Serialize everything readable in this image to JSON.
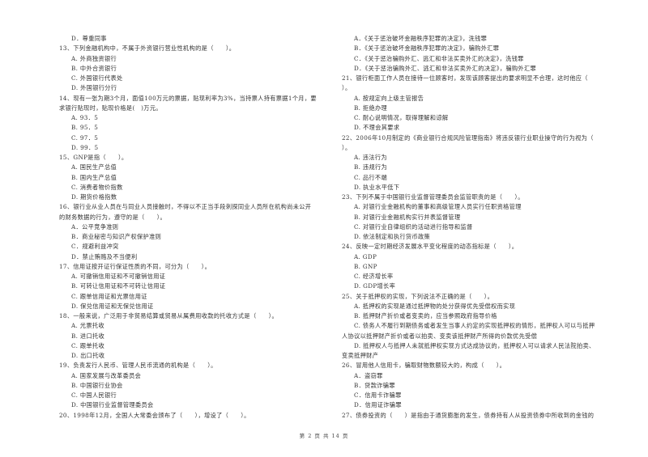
{
  "document": {
    "left_column": [
      {
        "type": "opt",
        "text": "D．尊重同事"
      },
      {
        "type": "q",
        "text": "13、下列金融机构中，不属于外资银行营业性机构的是（　　）。"
      },
      {
        "type": "opt",
        "text": "A. 外商独资银行"
      },
      {
        "type": "opt",
        "text": "B. 中外合资银行"
      },
      {
        "type": "opt",
        "text": "C. 外国银行代表处"
      },
      {
        "type": "opt",
        "text": "D. 外国银行分行"
      },
      {
        "type": "q",
        "text": "14、现有一张为期3个月，面值100万元的票据，贴现利率为3%，当持票人持有票据1个月，要"
      },
      {
        "type": "cont",
        "text": "求银行贴现时，贴现价格是(　)万元。"
      },
      {
        "type": "opt",
        "text": "A. 93．5"
      },
      {
        "type": "opt",
        "text": "B. 95．5"
      },
      {
        "type": "opt",
        "text": "C. 97．5"
      },
      {
        "type": "opt",
        "text": "D. 99．5"
      },
      {
        "type": "q",
        "text": "15、GNP是指（　　）。"
      },
      {
        "type": "opt",
        "text": "A. 国民生产总值"
      },
      {
        "type": "opt",
        "text": "B. 国内生产总值"
      },
      {
        "type": "opt",
        "text": "C. 消费者物价指数"
      },
      {
        "type": "opt",
        "text": "D. 期货价格指数"
      },
      {
        "type": "q",
        "text": "16、银行业从业人员在与同业人员接触时，不得以不正当手段刺探同业人员所在机构尚未公开"
      },
      {
        "type": "cont",
        "text": "的财务数据的行为，遵守的是（　　）。"
      },
      {
        "type": "opt",
        "text": "A．公平竞争准则"
      },
      {
        "type": "opt",
        "text": "B．商业秘密与知识产权保护准则"
      },
      {
        "type": "opt",
        "text": "C．规避利益冲突"
      },
      {
        "type": "opt",
        "text": "D．禁止贿赂及不当便利"
      },
      {
        "type": "q",
        "text": "17、信用证按开证行保证性质的不同，可分为（　　）。"
      },
      {
        "type": "opt",
        "text": "A. 可撤销信用证和不可撤销信用证"
      },
      {
        "type": "opt",
        "text": "B. 可转让信用证和不可转让信用证"
      },
      {
        "type": "opt",
        "text": "C. 跟单信用证和光票信用证"
      },
      {
        "type": "opt",
        "text": "D. 保兑信用证和无保兑信用证"
      },
      {
        "type": "q",
        "text": "18、一般来说，广泛用于非贸易结算或贸易从属费用收款的托收方式是（　　）。"
      },
      {
        "type": "opt",
        "text": "A. 光票托收"
      },
      {
        "type": "opt",
        "text": "B. 进口托收"
      },
      {
        "type": "opt",
        "text": "C. 跟单托收"
      },
      {
        "type": "opt",
        "text": "D. 出口托收"
      },
      {
        "type": "q",
        "text": "19、负责发行人民币、管理人民币流通的机构是（　　）。"
      },
      {
        "type": "opt",
        "text": "A. 国家发展与改革委员会"
      },
      {
        "type": "opt",
        "text": "B. 中国银行业协会"
      },
      {
        "type": "opt",
        "text": "C. 中国人民银行"
      },
      {
        "type": "opt",
        "text": "D. 中国银行业监督管理委员会"
      },
      {
        "type": "q",
        "text": "20、1998年12月，全国人大常委会颁布了（　　），增设了（　　）。"
      }
    ],
    "right_column": [
      {
        "type": "opt",
        "text": "A．《关于惩治破坏金融秩序犯罪的决定》，洗钱罪"
      },
      {
        "type": "opt",
        "text": "B．《关于惩治破坏金融秩序犯罪的决定》，骗购外汇罪"
      },
      {
        "type": "opt",
        "text": "C．《关于惩治骗购外汇、逃汇和非法买卖外汇的决定》，洗钱罪"
      },
      {
        "type": "opt",
        "text": "D．《关于惩治骗购外汇、逃汇和非法买卖外汇的决定》，骗购外汇罪"
      },
      {
        "type": "q",
        "text": "21、银行柜面工作人员在接待一位顾客时，发现该顾客提出的要求明显不合理，这时他应（"
      },
      {
        "type": "cont",
        "text": "）。"
      },
      {
        "type": "opt",
        "text": "A. 按规定向上级主管报告"
      },
      {
        "type": "opt",
        "text": "B. 拒绝办理"
      },
      {
        "type": "opt",
        "text": "C. 耐心说明情况，取得理解和谅解"
      },
      {
        "type": "opt",
        "text": "D. 不理会其要求"
      },
      {
        "type": "q",
        "text": "22、2006年10月制定的《商业银行合规风险管理指南》将违反银行业职业操守的行为视为（"
      },
      {
        "type": "cont",
        "text": "）。"
      },
      {
        "type": "opt",
        "text": "A. 违法行为"
      },
      {
        "type": "opt",
        "text": "B. 违规行为"
      },
      {
        "type": "opt",
        "text": "C. 品行不端"
      },
      {
        "type": "opt",
        "text": "D. 执业水平低下"
      },
      {
        "type": "q",
        "text": "23、下列不属于中国银行业监督管理委员会监管职责的是（　　）。"
      },
      {
        "type": "opt",
        "text": "A. 对银行业金融机构的董事和高级管理人员实行任职资格管理"
      },
      {
        "type": "opt",
        "text": "B. 对银行业金融机构实行并表监督管理"
      },
      {
        "type": "opt",
        "text": "C. 对银行业自律组织的活动进行指导和监督"
      },
      {
        "type": "opt",
        "text": "D. 依法制定和执行货币政策"
      },
      {
        "type": "q",
        "text": "24、反映一定时期经济发展水平变化程度的动态指标是（　　）。"
      },
      {
        "type": "opt",
        "text": "A. GDP"
      },
      {
        "type": "opt",
        "text": "B. GNP"
      },
      {
        "type": "opt",
        "text": "C. 经济增长率"
      },
      {
        "type": "opt",
        "text": "D. GDP增长率"
      },
      {
        "type": "q",
        "text": "25、关于抵押权的实现，下列说法不正确的是（　　）。"
      },
      {
        "type": "opt",
        "text": "A. 抵押权的实现是通过抵押物的处分获得优先受偿权而实现"
      },
      {
        "type": "opt",
        "text": "B. 抵押财产折价或者变卖的，应当参照政府指导价格"
      },
      {
        "type": "opt",
        "text": "C. 债务人不履行到期债务或者发生当事人约定的实现抵押权的情形，抵押权人可以与抵押"
      },
      {
        "type": "cont",
        "text": "人协议以抵押财产折价或者以拍卖、变卖该抵押财产所得的价款优先受偿"
      },
      {
        "type": "opt",
        "text": "D. 抵押权人与抵押人未就抵押权实现方式达成协议的，抵押权人可以请求人民法院拍卖、"
      },
      {
        "type": "cont",
        "text": "变卖抵押财产"
      },
      {
        "type": "q",
        "text": "26、冒用他人信用卡，骗取财物数额较大的，构成（　　）。"
      },
      {
        "type": "opt",
        "text": "A．盗窃罪"
      },
      {
        "type": "opt",
        "text": "B．贷款诈骗罪"
      },
      {
        "type": "opt",
        "text": "C．信用卡诈骗罪"
      },
      {
        "type": "opt",
        "text": "D．信用证诈骗罪"
      },
      {
        "type": "q",
        "text": "27、债券投资的（　　）是指由于通货膨胀的发生，债券持有人从投资债券中所收到的金钱的"
      }
    ]
  },
  "footer": {
    "page_indicator": "第 2 页 共 14 页"
  }
}
